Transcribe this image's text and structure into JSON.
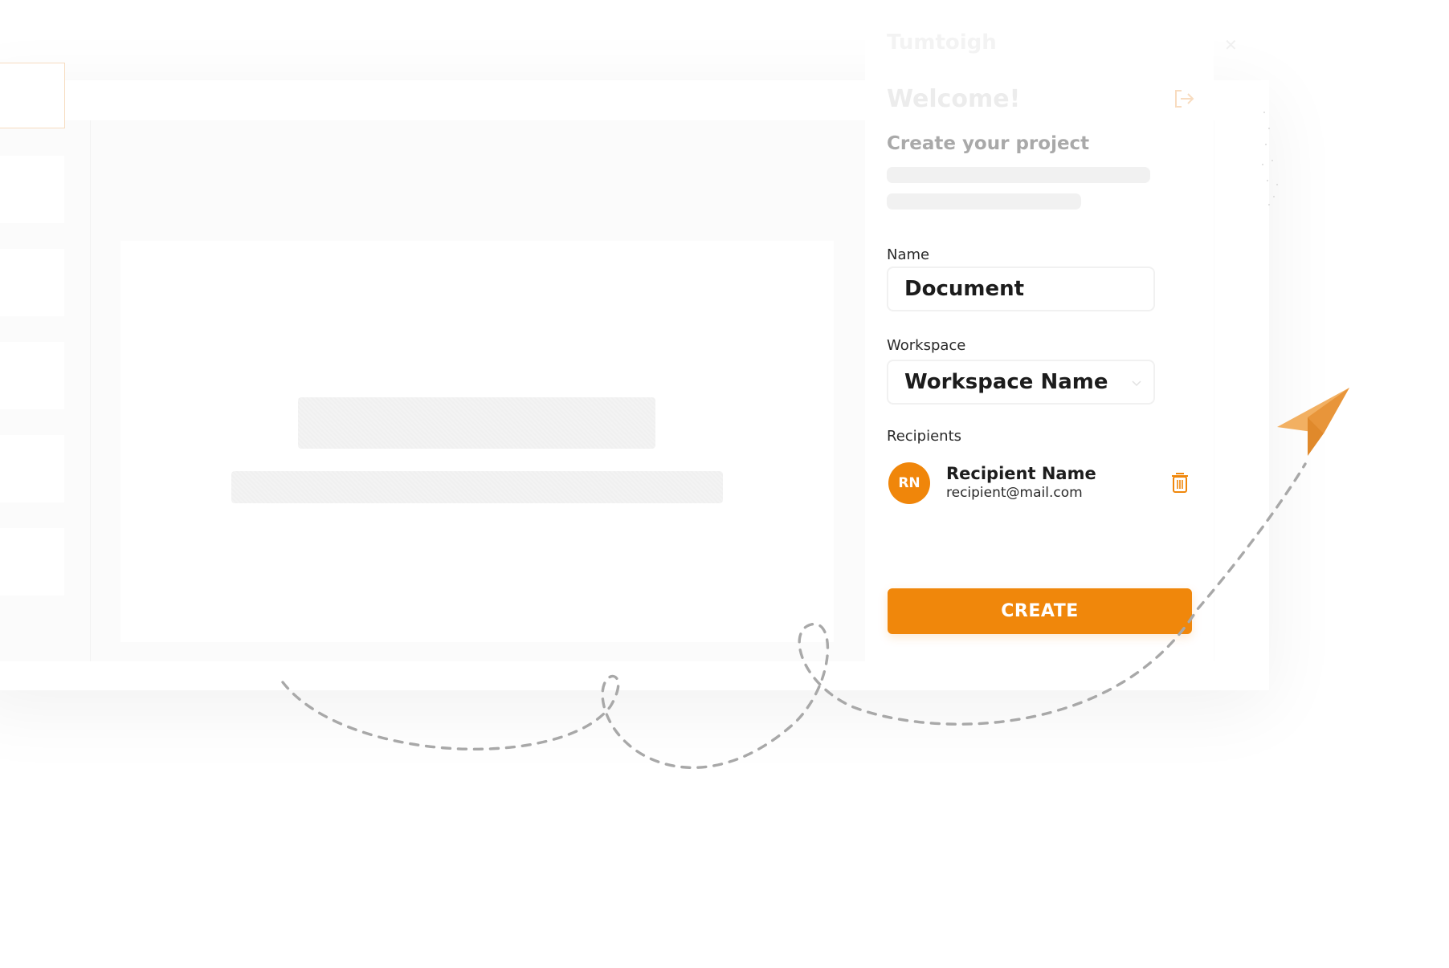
{
  "panel": {
    "brand_faded": "Tumtoigh",
    "welcome": "Welcome!",
    "subtitle": "Create your project"
  },
  "form": {
    "name_label": "Name",
    "name_value": "Document",
    "workspace_label": "Workspace",
    "workspace_value": "Workspace Name",
    "recipients_label": "Recipients"
  },
  "recipient": {
    "initials": "RN",
    "name": "Recipient Name",
    "email": "recipient@mail.com"
  },
  "actions": {
    "create_label": "CREATE"
  },
  "icons": {
    "logout": "logout-icon",
    "chevron": "chevron-down-icon",
    "trash": "trash-icon",
    "plane": "paper-plane-icon"
  },
  "colors": {
    "accent": "#f0870b",
    "plane_light": "#f2b062",
    "plane_dark": "#e8953a",
    "dash": "#a8a8a8"
  }
}
